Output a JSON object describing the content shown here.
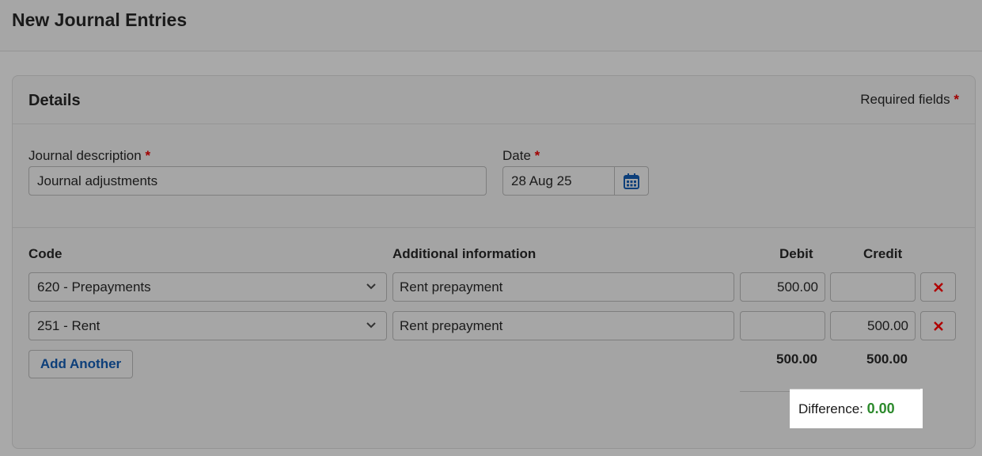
{
  "page": {
    "title": "New Journal Entries"
  },
  "card": {
    "title": "Details",
    "required_label": "Required fields",
    "required_marker": "*"
  },
  "form": {
    "description_label": "Journal description",
    "description_value": "Journal adjustments",
    "date_label": "Date",
    "date_value": "28 Aug 25"
  },
  "table": {
    "headers": {
      "code": "Code",
      "info": "Additional information",
      "debit": "Debit",
      "credit": "Credit"
    },
    "rows": [
      {
        "code": "620 - Prepayments",
        "info": "Rent prepayment",
        "debit": "500.00",
        "credit": ""
      },
      {
        "code": "251 - Rent",
        "info": "Rent prepayment",
        "debit": "",
        "credit": "500.00"
      }
    ],
    "add_label": "Add Another",
    "total_debit": "500.00",
    "total_credit": "500.00",
    "difference_label": "Difference:",
    "difference_value": "0.00"
  },
  "icons": {
    "calendar": "calendar-icon",
    "chevron": "chevron-down-icon",
    "delete": "close-icon"
  },
  "colors": {
    "accent": "#0d3f7a",
    "required": "#a10000",
    "delete": "#b00000",
    "difference_ok": "#2c8a2c"
  }
}
